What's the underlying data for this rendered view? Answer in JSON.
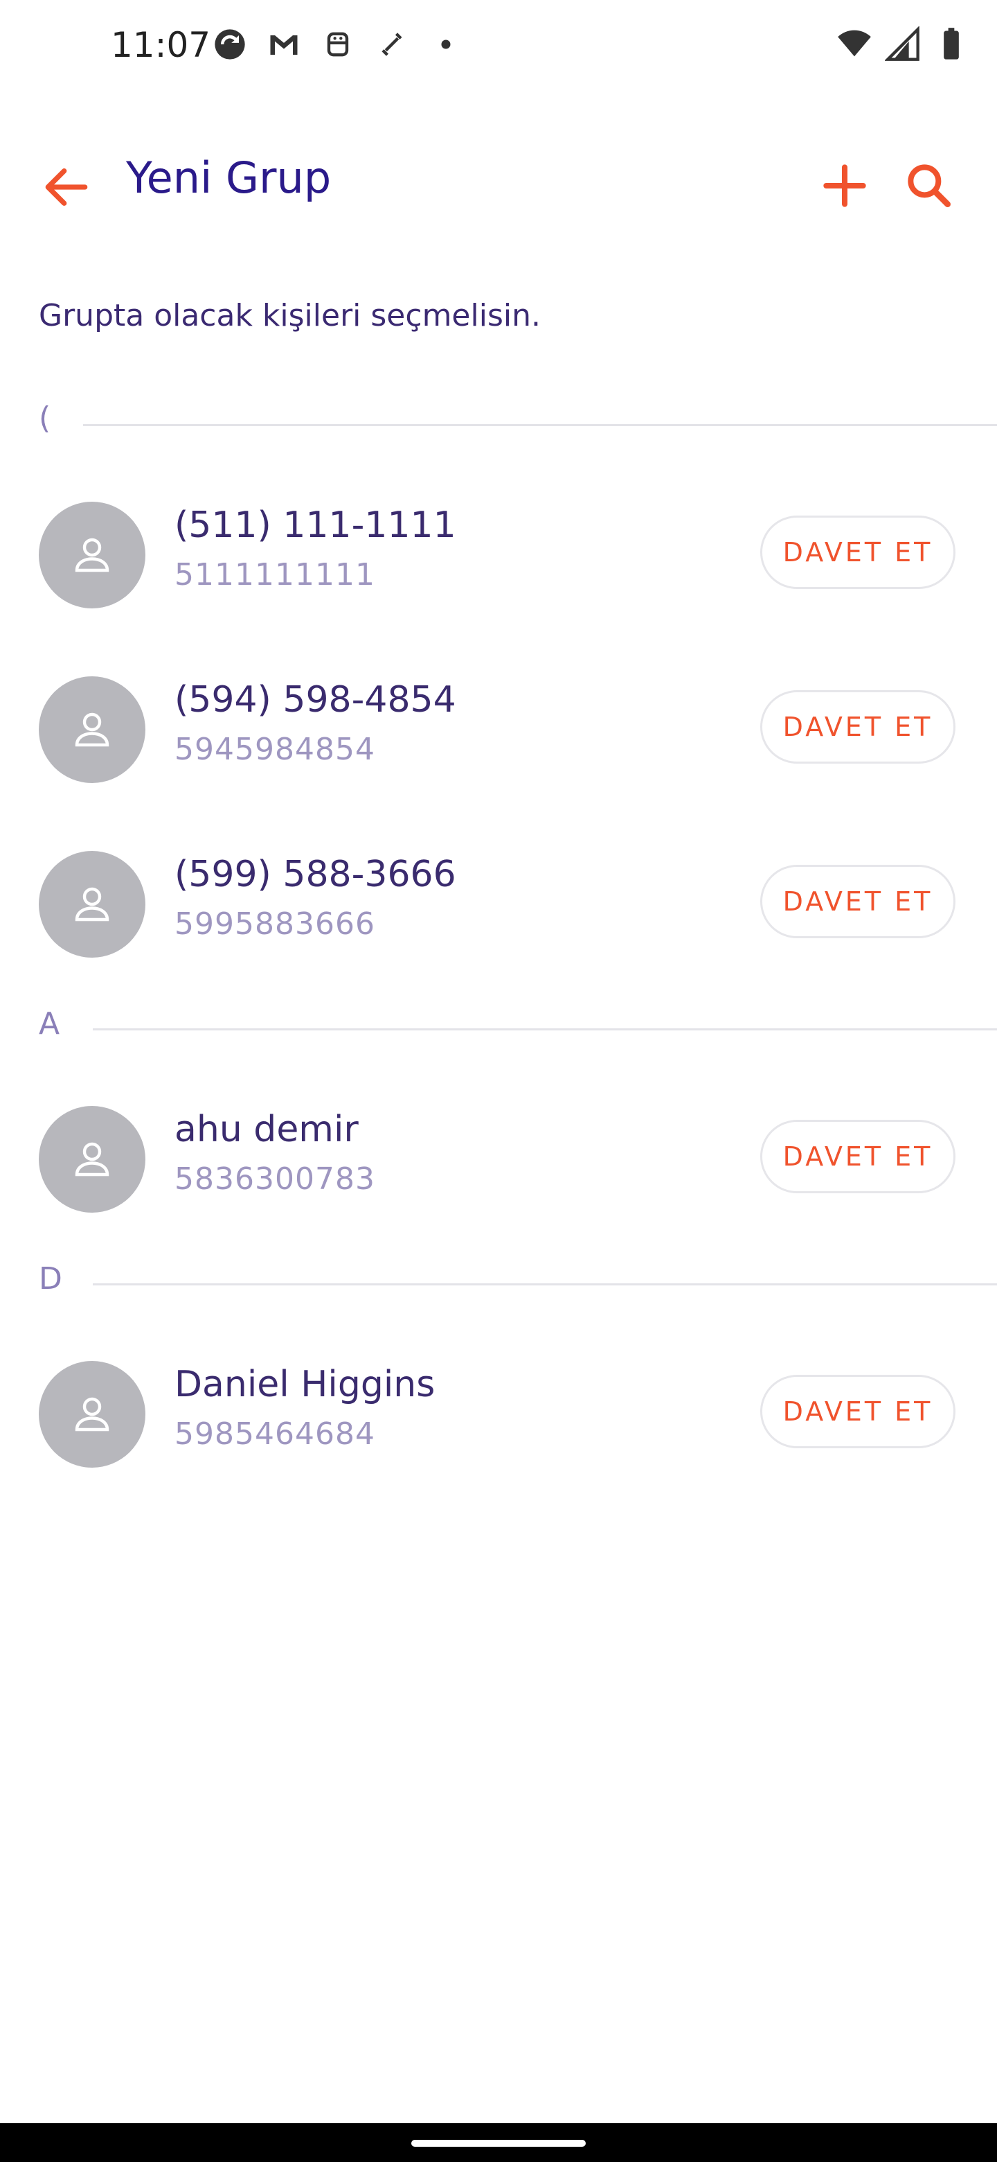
{
  "status_bar": {
    "time": "11:07",
    "left_icons": [
      "sync-icon",
      "gmail-icon",
      "android-bot-icon",
      "phone-link-icon",
      "dot-icon"
    ],
    "right_icons": [
      "wifi-icon",
      "cell-signal-icon",
      "battery-icon"
    ]
  },
  "app_bar": {
    "title": "Yeni Grup",
    "back_icon": "arrow-back-icon",
    "add_icon": "plus-icon",
    "search_icon": "search-icon",
    "accent_color": "#f0532d"
  },
  "hint": "Grupta olacak kişileri seçmelisin.",
  "sections": [
    {
      "letter": "(",
      "contacts": [
        {
          "name": "(511) 111-1111",
          "number": "5111111111",
          "action": "DAVET ET"
        },
        {
          "name": "(594) 598-4854",
          "number": "5945984854",
          "action": "DAVET ET"
        },
        {
          "name": "(599) 588-3666",
          "number": "5995883666",
          "action": "DAVET ET"
        }
      ]
    },
    {
      "letter": "A",
      "contacts": [
        {
          "name": "ahu demir",
          "number": "5836300783",
          "action": "DAVET ET"
        }
      ]
    },
    {
      "letter": "D",
      "contacts": [
        {
          "name": "Daniel Higgins",
          "number": "5985464684",
          "action": "DAVET ET"
        }
      ]
    }
  ]
}
